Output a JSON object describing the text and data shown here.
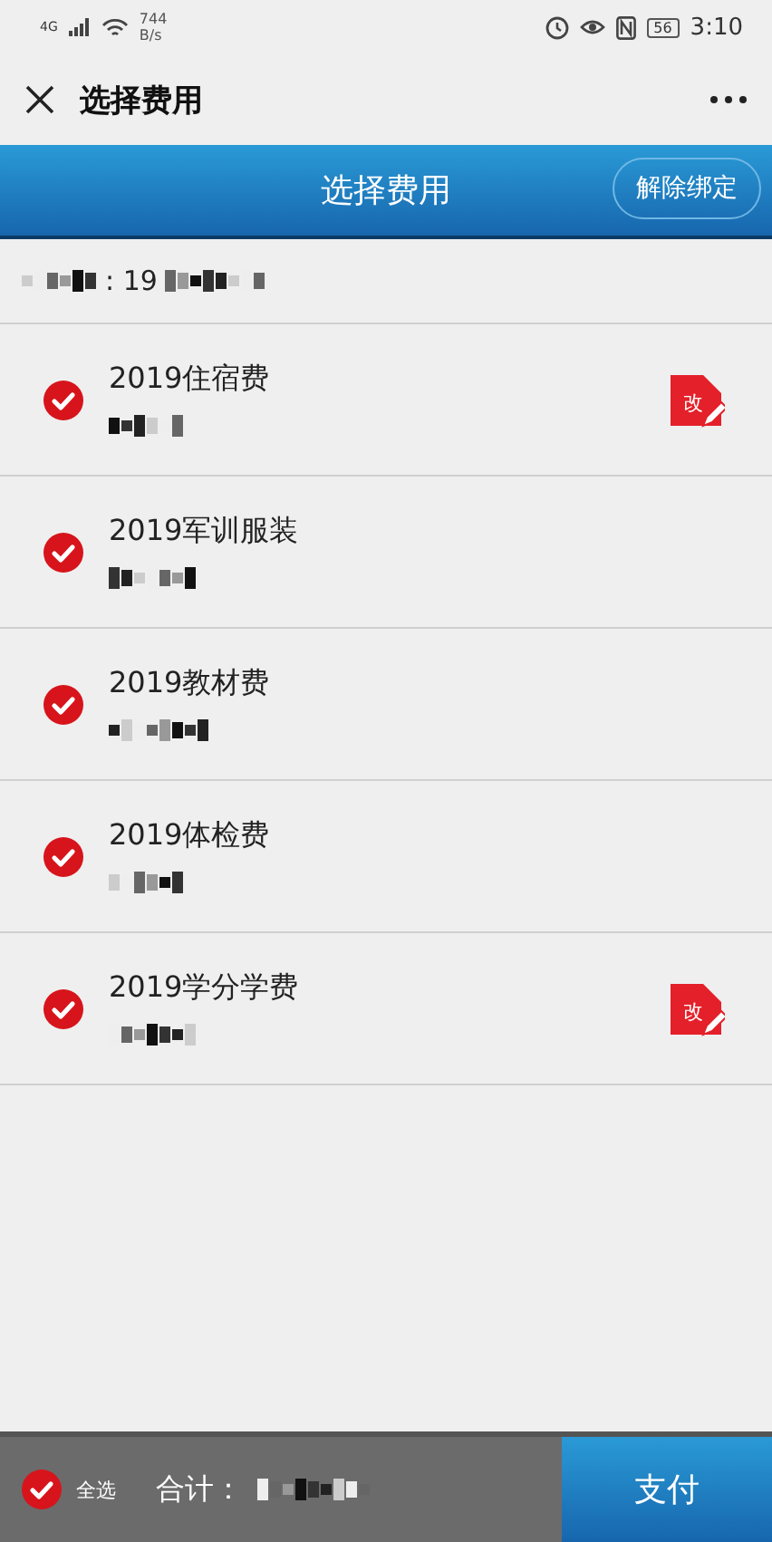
{
  "status_bar": {
    "network": "4G",
    "speed": "744",
    "speed_unit": "B/s",
    "battery": "56",
    "time": "3:10"
  },
  "nav_bar": {
    "title": "选择费用"
  },
  "header": {
    "title": "选择费用",
    "action": "解除绑定"
  },
  "account": {
    "visible_part": ": 19"
  },
  "fees": [
    {
      "name": "2019住宿费",
      "checked": true,
      "edit_label": "改"
    },
    {
      "name": "2019军训服装",
      "checked": true
    },
    {
      "name": "2019教材费",
      "checked": true
    },
    {
      "name": "2019体检费",
      "checked": true
    },
    {
      "name": "2019学分学费",
      "checked": true,
      "edit_label": "改"
    }
  ],
  "footer": {
    "select_all": {
      "label": "全选",
      "checked": true
    },
    "total_label": "合计：",
    "pay": "支付"
  }
}
